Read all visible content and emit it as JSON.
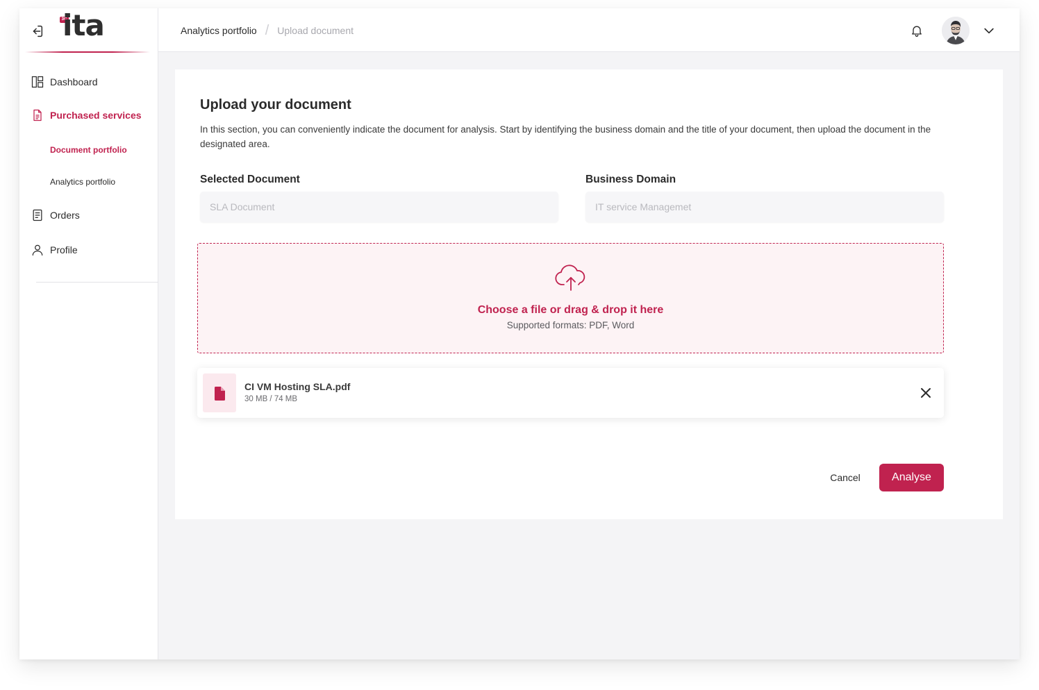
{
  "app": {
    "logo_text": "ita",
    "logo_badge": "3C",
    "accent_color": "#c0224f"
  },
  "sidebar": {
    "items": [
      {
        "label": "Dashboard",
        "icon": "dashboard-icon"
      },
      {
        "label": "Purchased services",
        "icon": "document-icon"
      },
      {
        "label": "Document portfolio"
      },
      {
        "label": "Analytics portfolio"
      },
      {
        "label": "Orders",
        "icon": "orders-icon"
      },
      {
        "label": "Profile",
        "icon": "user-icon"
      }
    ]
  },
  "header": {
    "breadcrumb": [
      "Analytics portfolio",
      "Upload document"
    ],
    "separator": "/"
  },
  "main": {
    "title": "Upload your document",
    "description": " In this section, you can conveniently indicate the document for analysis. Start by identifying the business domain and the title of your document, then upload the document in the designated area.",
    "selected_document": {
      "label": "Selected Document",
      "placeholder": "SLA Document"
    },
    "business_domain": {
      "label": "Business Domain",
      "placeholder": "IT service Managemet"
    },
    "dropzone": {
      "title": "Choose a file or drag & drop it here",
      "subtitle": "Supported formats: PDF, Word"
    },
    "file": {
      "name": "CI VM Hosting SLA.pdf",
      "size": "30 MB / 74 MB"
    },
    "cancel_label": "Cancel",
    "analyse_label": "Analyse"
  }
}
